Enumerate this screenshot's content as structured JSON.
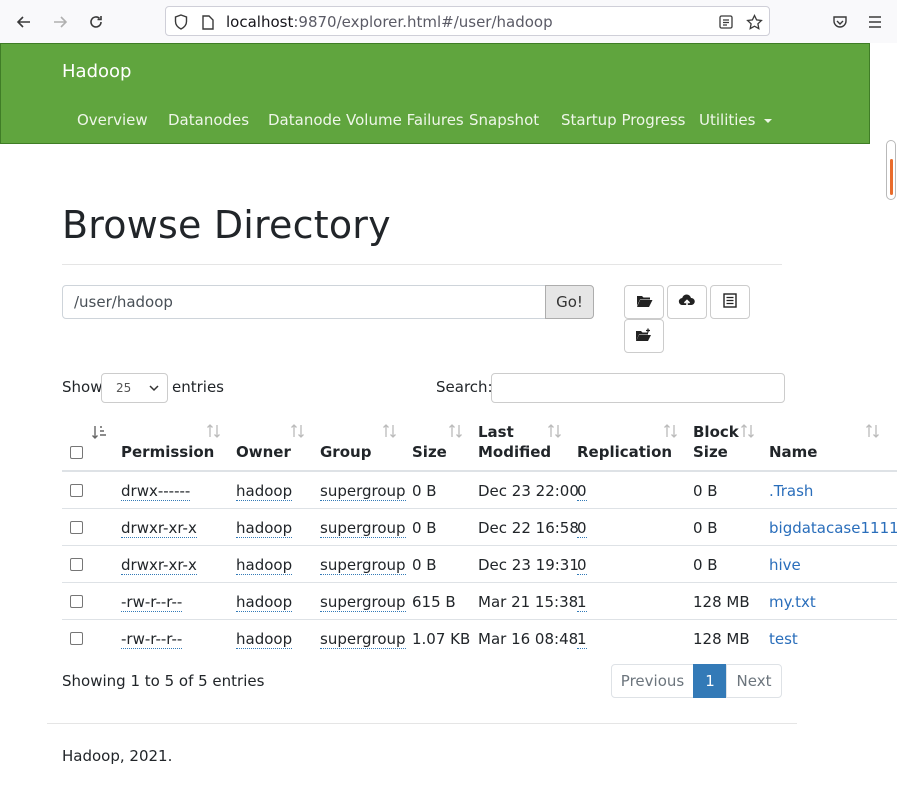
{
  "browser": {
    "url_host": "localhost",
    "url_rest": ":9870/explorer.html#/user/hadoop"
  },
  "navbar": {
    "brand": "Hadoop",
    "items": [
      "Overview",
      "Datanodes",
      "Datanode Volume Failures",
      "Snapshot",
      "Startup Progress",
      "Utilities"
    ]
  },
  "page": {
    "title": "Browse Directory",
    "path_value": "/user/hadoop",
    "go_label": "Go!"
  },
  "table_controls": {
    "show_label": "Show",
    "entries_value": "25",
    "entries_label": "entries",
    "search_label": "Search:"
  },
  "table": {
    "headers": {
      "permission": "Permission",
      "owner": "Owner",
      "group": "Group",
      "size": "Size",
      "last_modified_1": "Last",
      "last_modified_2": "Modified",
      "replication": "Replication",
      "block_size_1": "Block",
      "block_size_2": "Size",
      "name": "Name"
    },
    "rows": [
      {
        "permission": "drwx------",
        "owner": "hadoop",
        "group": "supergroup",
        "size": "0 B",
        "modified": "Dec 23 22:00",
        "replication": "0",
        "block_size": "0 B",
        "name": ".Trash"
      },
      {
        "permission": "drwxr-xr-x",
        "owner": "hadoop",
        "group": "supergroup",
        "size": "0 B",
        "modified": "Dec 22 16:58",
        "replication": "0",
        "block_size": "0 B",
        "name": "bigdatacase1111"
      },
      {
        "permission": "drwxr-xr-x",
        "owner": "hadoop",
        "group": "supergroup",
        "size": "0 B",
        "modified": "Dec 23 19:31",
        "replication": "0",
        "block_size": "0 B",
        "name": "hive"
      },
      {
        "permission": "-rw-r--r--",
        "owner": "hadoop",
        "group": "supergroup",
        "size": "615 B",
        "modified": "Mar 21 15:38",
        "replication": "1",
        "block_size": "128 MB",
        "name": "my.txt"
      },
      {
        "permission": "-rw-r--r--",
        "owner": "hadoop",
        "group": "supergroup",
        "size": "1.07 KB",
        "modified": "Mar 16 08:48",
        "replication": "1",
        "block_size": "128 MB",
        "name": "test"
      }
    ]
  },
  "pagination": {
    "info": "Showing 1 to 5 of 5 entries",
    "previous": "Previous",
    "current": "1",
    "next": "Next"
  },
  "footer": {
    "text": "Hadoop, 2021."
  },
  "colors": {
    "navbar": "#60a53e",
    "link": "#2a6ebb",
    "page_active": "#337ab7"
  }
}
